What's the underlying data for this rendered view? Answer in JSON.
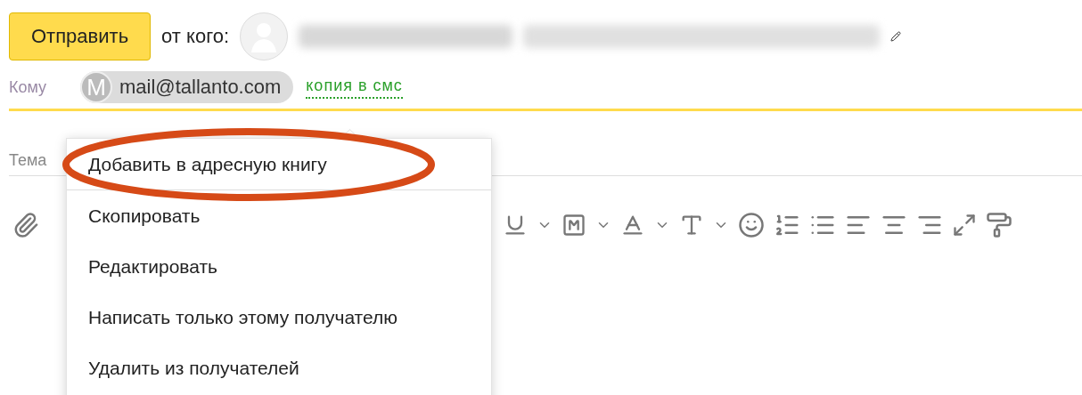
{
  "compose": {
    "send_button": "Отправить",
    "from_label": "от кого:",
    "to_label": "Кому",
    "recipients": [
      {
        "initial": "M",
        "email": "mail@tallanto.com"
      }
    ],
    "sms_copy_link": "копия в смс",
    "subject_label": "Тема"
  },
  "context_menu": {
    "items": [
      {
        "label": "Добавить в адресную книгу",
        "highlighted": true
      },
      {
        "label": "Скопировать",
        "highlighted": false
      },
      {
        "label": "Редактировать",
        "highlighted": false
      },
      {
        "label": "Написать только этому получателю",
        "highlighted": false
      },
      {
        "label": "Удалить из получателей",
        "highlighted": false
      }
    ]
  }
}
